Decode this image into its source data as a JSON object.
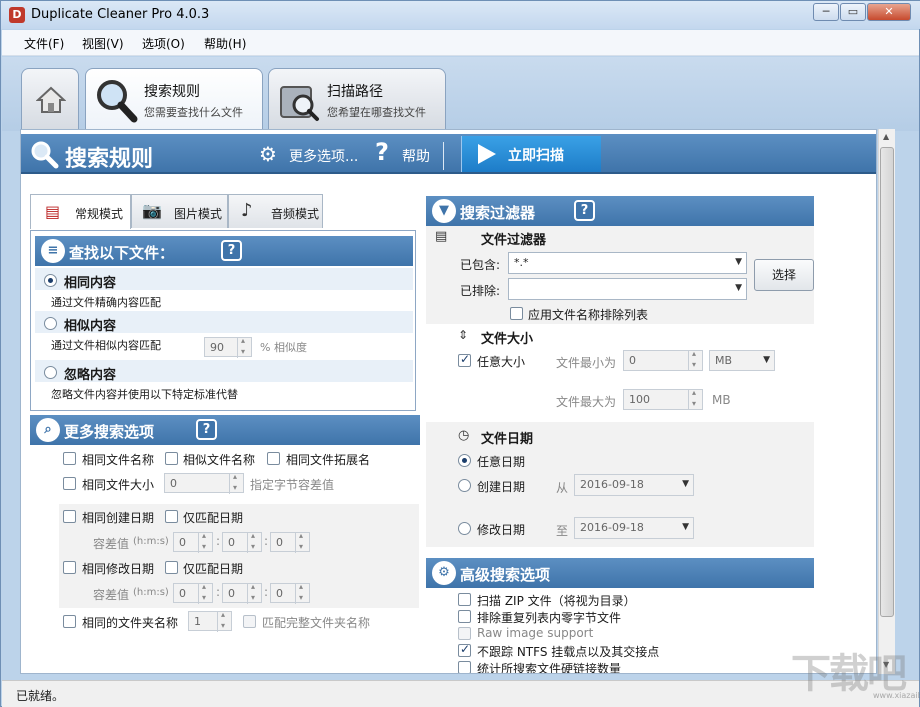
{
  "window": {
    "title": "Duplicate Cleaner Pro 4.0.3",
    "min": "─",
    "max": "▭",
    "close": "✕"
  },
  "menu": [
    "文件(F)",
    "视图(V)",
    "选项(O)",
    "帮助(H)"
  ],
  "nav": {
    "search": {
      "title": "搜索规则",
      "sub": "您需要查找什么文件"
    },
    "path": {
      "title": "扫描路径",
      "sub": "您希望在哪查找文件"
    }
  },
  "header": {
    "title": "搜索规则",
    "more": "更多选项...",
    "help": "帮助",
    "scan": "立即扫描"
  },
  "modes": [
    "常规模式",
    "图片模式",
    "音频模式"
  ],
  "find": {
    "title": "查找以下文件：",
    "help": "?",
    "same": "相同内容",
    "same_desc": "通过文件精确内容匹配",
    "similar": "相似内容",
    "similar_desc": "通过文件相似内容匹配",
    "similar_value": "90",
    "similar_unit": "% 相似度",
    "ignore": "忽略内容",
    "ignore_desc": "忽略文件内容并使用以下特定标准代替"
  },
  "more": {
    "title": "更多搜索选项",
    "help": "?",
    "same_name": "相同文件名称",
    "similar_name": "相似文件名称",
    "same_ext": "相同文件拓展名",
    "same_size": "相同文件大小",
    "size_value": "0",
    "size_hint": "指定字节容差值",
    "same_created": "相同创建日期",
    "only_date1": "仅匹配日期",
    "tol1": "容差值",
    "tol1_unit": "(h:m:s)",
    "t1a": "0",
    "t1b": "0",
    "t1c": "0",
    "colon": ":",
    "same_modified": "相同修改日期",
    "only_date2": "仅匹配日期",
    "tol2": "容差值",
    "tol2_unit": "(h:m:s)",
    "t2a": "0",
    "t2b": "0",
    "t2c": "0",
    "same_folder": "相同的文件夹名称",
    "folder_value": "1",
    "full_folder": "匹配完整文件夹名称"
  },
  "filter": {
    "title": "搜索过滤器",
    "help": "?",
    "file_filter": "文件过滤器",
    "include": "已包含:",
    "include_value": "*.*",
    "exclude": "已排除:",
    "exclude_value": "",
    "select": "选择",
    "apply_exclude": "应用文件名称排除列表",
    "size_title": "文件大小",
    "any_size": "任意大小",
    "min_label": "文件最小为",
    "min_value": "0",
    "min_unit": "MB",
    "max_label": "文件最大为",
    "max_value": "100",
    "max_unit": "MB",
    "date_title": "文件日期",
    "any_date": "任意日期",
    "created": "创建日期",
    "from": "从",
    "from_date": "2016-09-18",
    "modified": "修改日期",
    "to": "至",
    "to_date": "2016-09-18"
  },
  "advanced": {
    "title": "高级搜索选项",
    "zip": "扫描 ZIP 文件（将视为目录）",
    "zero": "排除重复列表内零字节文件",
    "raw": "Raw image support",
    "ntfs": "不跟踪 NTFS 挂载点以及其交接点",
    "hardlink": "统计所搜索文件硬链接数量"
  },
  "status": "已就绪。",
  "watermark": "下载吧",
  "watermark_url": "www.xiazaiba.com"
}
